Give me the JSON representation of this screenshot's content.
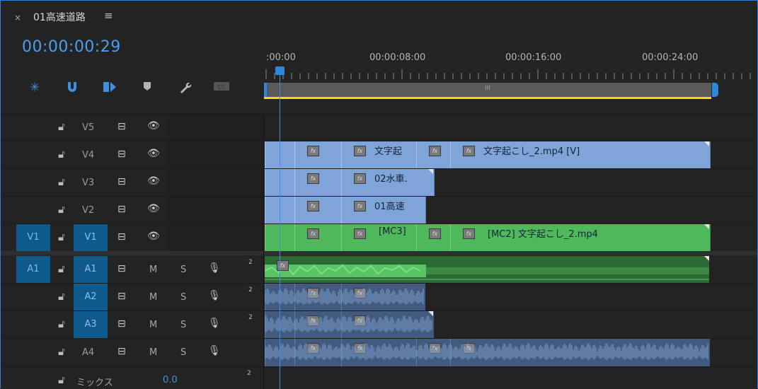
{
  "tab": {
    "close": "×",
    "title": "01高速道路",
    "menu": "≡"
  },
  "timecode": "00:00:00:29",
  "ruler": {
    "labels": [
      ":00:00",
      "00:00:08:00",
      "00:00:16:00",
      "00:00:24:00"
    ]
  },
  "scrollbar_grip": "III",
  "video_tracks": [
    {
      "target": "",
      "name": "V5"
    },
    {
      "target": "",
      "name": "V4"
    },
    {
      "target": "",
      "name": "V3"
    },
    {
      "target": "",
      "name": "V2"
    },
    {
      "target": "V1",
      "name": "V1"
    }
  ],
  "audio_tracks": [
    {
      "target": "A1",
      "name": "A1",
      "m": "M",
      "s": "S",
      "channels": "2"
    },
    {
      "target": "",
      "name": "A2",
      "m": "M",
      "s": "S",
      "channels": "2"
    },
    {
      "target": "",
      "name": "A3",
      "m": "M",
      "s": "S",
      "channels": "2"
    },
    {
      "target": "",
      "name": "A4",
      "m": "M",
      "s": "S",
      "channels": ""
    }
  ],
  "mix": {
    "label": "ミックス",
    "value": "0.0",
    "channels": "2"
  },
  "clips": {
    "v4_c": "文字起",
    "v4_e": "文字起こし_2.mp4 [V]",
    "v3_c": "02水車.",
    "v2_c": "01高速",
    "v1_c": "[MC3]",
    "v1_e": "[MC2] 文字起こし_2.mp4"
  },
  "fx_label": "fx",
  "icons": {
    "lock": "lock-icon",
    "film": "film-toggle-icon",
    "eye": "eye-icon",
    "mic": "microphone-icon"
  },
  "colors": {
    "accent": "#2d7fd3",
    "video_clip": "#7ea4d8",
    "multicam_clip": "#4fb85a",
    "audio_clip": "#415a7d",
    "work_area": "#f0e000"
  }
}
